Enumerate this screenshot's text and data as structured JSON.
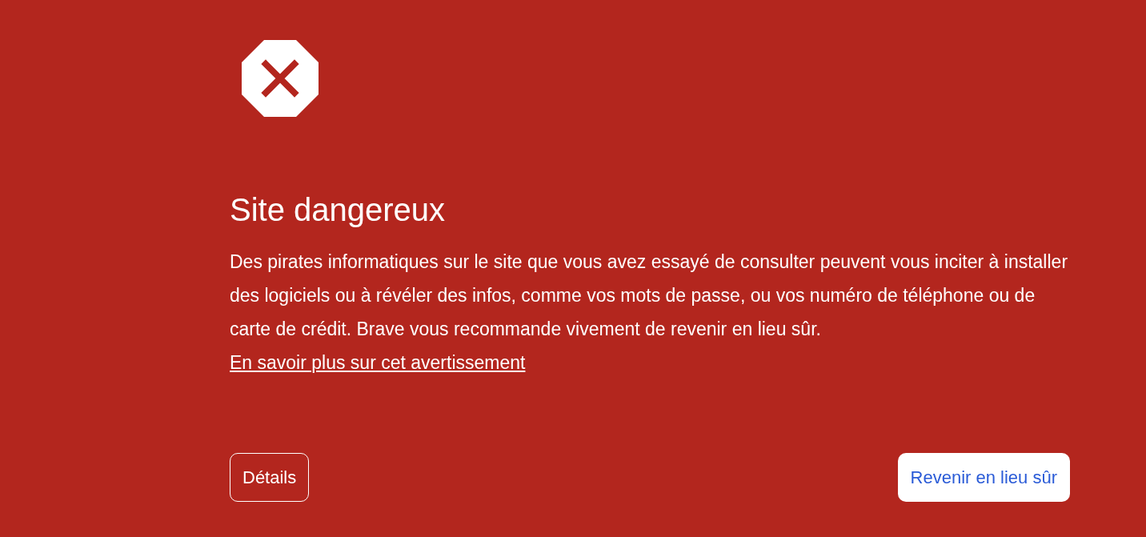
{
  "title": "Site dangereux",
  "message": {
    "text": "Des pirates informatiques sur le site que vous avez essayé de consulter peuvent vous inciter à installer des logiciels ou à révéler des infos, comme vos mots de passe, ou vos numéro de téléphone ou de carte de crédit. Brave vous recommande vivement de revenir en lieu sûr.",
    "link": "En savoir plus sur cet avertissement"
  },
  "buttons": [
    {
      "label": "Détails",
      "kind": "secondary"
    },
    {
      "label": "Revenir en lieu sûr",
      "kind": "primary"
    }
  ]
}
